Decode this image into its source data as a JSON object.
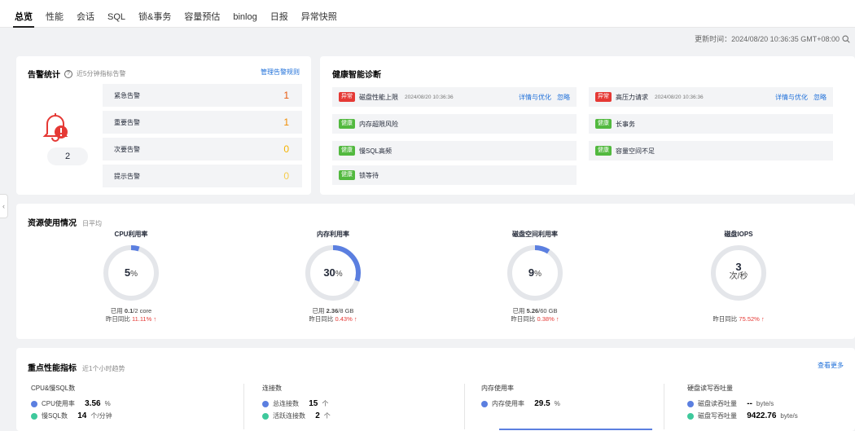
{
  "tabs": [
    {
      "label": "总览",
      "active": true
    },
    {
      "label": "性能"
    },
    {
      "label": "会话"
    },
    {
      "label": "SQL"
    },
    {
      "label": "锁&事务"
    },
    {
      "label": "容量预估"
    },
    {
      "label": "binlog"
    },
    {
      "label": "日报"
    },
    {
      "label": "异常快照"
    }
  ],
  "updated": "更新时间：2024/08/20 10:36:35 GMT+08:00",
  "alarm": {
    "title": "告警统计",
    "subtitle": "近5分钟指标告警",
    "manage_link": "管理告警规则",
    "total": "2",
    "rows": [
      {
        "label": "紧急告警",
        "value": "1",
        "color": "#e8590c"
      },
      {
        "label": "重要告警",
        "value": "1",
        "color": "#f08c00"
      },
      {
        "label": "次要告警",
        "value": "0",
        "color": "#f5b300"
      },
      {
        "label": "提示告警",
        "value": "0",
        "color": "#f5cc4c"
      }
    ]
  },
  "health": {
    "title": "健康智能诊断",
    "items": [
      {
        "status": "异常",
        "type": "abn",
        "label": "磁盘性能上限",
        "time": "2024/08/20 10:36:36",
        "link1": "详情与优化",
        "link2": "忽略"
      },
      {
        "status": "异常",
        "type": "abn",
        "label": "高压力请求",
        "time": "2024/08/20 10:36:36",
        "link1": "详情与优化",
        "link2": "忽略"
      },
      {
        "status": "健康",
        "type": "ok",
        "label": "内存超限风险"
      },
      {
        "status": "健康",
        "type": "ok",
        "label": "长事务"
      },
      {
        "status": "健康",
        "type": "ok",
        "label": "慢SQL高频"
      },
      {
        "status": "健康",
        "type": "ok",
        "label": "容量空间不足"
      },
      {
        "status": "健康",
        "type": "ok",
        "label": "锁等待"
      }
    ]
  },
  "resource": {
    "title": "资源使用情况",
    "subtitle": "日平均",
    "gauges": [
      {
        "title": "CPU利用率",
        "value": "5",
        "unit": "%",
        "fraction": 0.05,
        "used_prefix": "已用 ",
        "used_val": "0.1",
        "used_suffix": "/2 core",
        "cmp_label": "昨日同比 ",
        "cmp_val": "11.11%",
        "arrow": "↑"
      },
      {
        "title": "内存利用率",
        "value": "30",
        "unit": "%",
        "fraction": 0.3,
        "used_prefix": "已用 ",
        "used_val": "2.36",
        "used_suffix": "/8 GB",
        "cmp_label": "昨日同比 ",
        "cmp_val": "0.43%",
        "arrow": "↑"
      },
      {
        "title": "磁盘空间利用率",
        "value": "9",
        "unit": "%",
        "fraction": 0.09,
        "used_prefix": "已用 ",
        "used_val": "5.26",
        "used_suffix": "/60 GB",
        "cmp_label": "昨日同比 ",
        "cmp_val": "0.38%",
        "arrow": "↑"
      },
      {
        "title": "磁盘IOPS",
        "value": "3",
        "unit": "次/秒",
        "fraction": 0,
        "used_prefix": "",
        "used_val": "",
        "used_suffix": "",
        "cmp_label": "昨日同比 ",
        "cmp_val": "75.52%",
        "arrow": "↑"
      }
    ]
  },
  "perf": {
    "title": "重点性能指标",
    "subtitle": "近1个小时趋势",
    "more": "查看更多",
    "columns": [
      {
        "title": "CPU&慢SQL数",
        "metrics": [
          {
            "label": "CPU使用率",
            "value": "3.56",
            "unit": "%",
            "color": "#5b7fe0"
          },
          {
            "label": "慢SQL数",
            "value": "14",
            "unit": "个/分钟",
            "color": "#3ec99c"
          }
        ]
      },
      {
        "title": "连接数",
        "metrics": [
          {
            "label": "总连接数",
            "value": "15",
            "unit": "个",
            "color": "#5b7fe0"
          },
          {
            "label": "活跃连接数",
            "value": "2",
            "unit": "个",
            "color": "#3ec99c"
          }
        ]
      },
      {
        "title": "内存使用率",
        "metrics": [
          {
            "label": "内存使用率",
            "value": "29.5",
            "unit": "%",
            "color": "#5b7fe0"
          }
        ]
      },
      {
        "title": "硬盘读写吞吐量",
        "metrics": [
          {
            "label": "磁盘读吞吐量",
            "value": "--",
            "unit": "byte/s",
            "color": "#5b7fe0"
          },
          {
            "label": "磁盘写吞吐量",
            "value": "9422.76",
            "unit": "byte/s",
            "color": "#3ec99c"
          }
        ]
      }
    ]
  },
  "colors": {
    "accent": "#5b7fe0",
    "abnormal": "#e53935",
    "healthy": "#52b93f",
    "link": "#1e6fd9"
  }
}
